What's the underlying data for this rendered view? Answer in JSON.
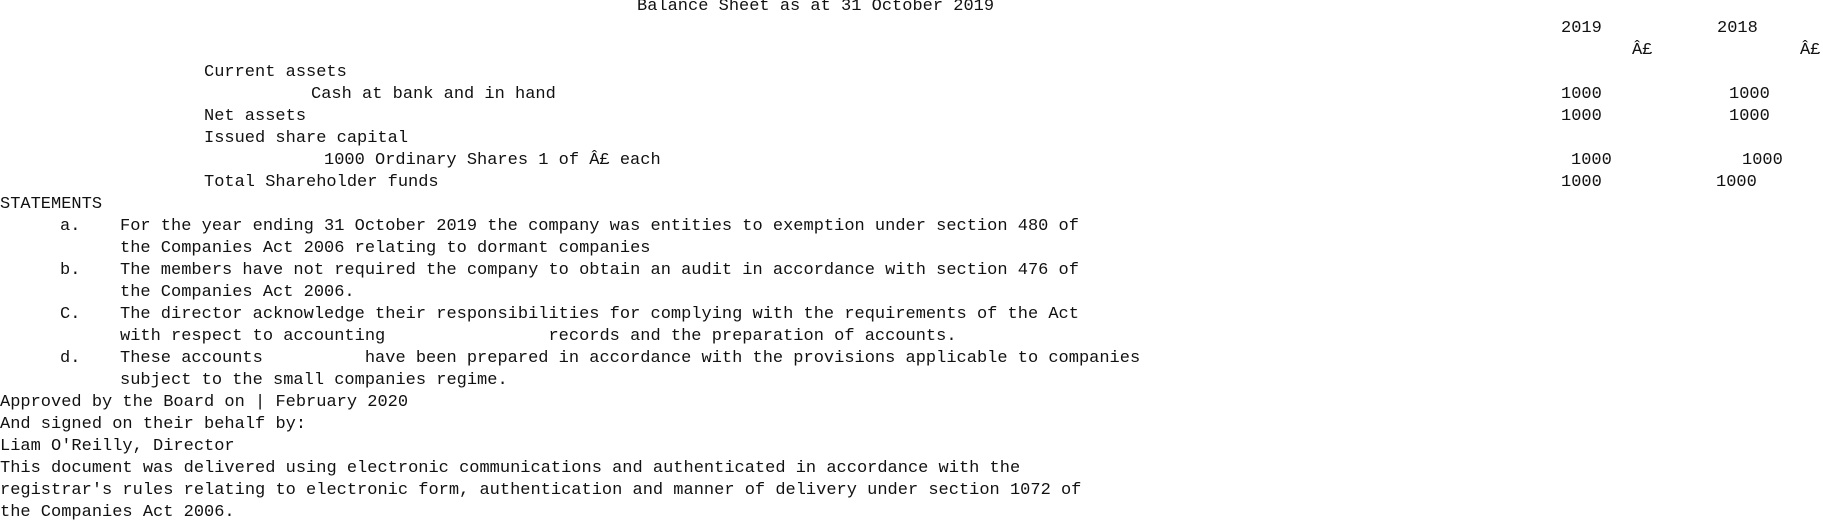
{
  "title": "Balance Sheet as at 31 October 2019",
  "columns": {
    "year_current": "2019",
    "year_prior": "2018",
    "currency_current": "Â£",
    "currency_prior": "Â£"
  },
  "balance_sheet": {
    "current_assets_label": "Current assets",
    "cash_label": "Cash at bank and in hand",
    "cash_2019": "1000",
    "cash_2018": "1000",
    "net_assets_label": "Net assets",
    "net_assets_2019": "1000",
    "net_assets_2018": "1000",
    "issued_share_capital_label": "Issued share capital",
    "shares_label": "1000 Ordinary Shares 1 of Â£ each",
    "shares_2019": "1000",
    "shares_2018": "1000",
    "total_funds_label": "Total Shareholder funds",
    "total_funds_2019": "1000",
    "total_funds_2018": "1000"
  },
  "statements": {
    "heading": "STATEMENTS",
    "items": [
      {
        "marker": "a.",
        "lines": [
          "For the year ending 31 October 2019 the company was entities to exemption under section 480 of",
          "the Companies Act 2006 relating to dormant companies"
        ]
      },
      {
        "marker": "b.",
        "lines": [
          "The members have not required the company to obtain an audit in accordance with section 476 of",
          "the Companies Act 2006."
        ]
      },
      {
        "marker": "C.",
        "lines": [
          "The director acknowledge their responsibilities for complying with the requirements of the Act",
          "with respect to accounting                records and the preparation of accounts."
        ]
      },
      {
        "marker": "d.",
        "lines": [
          "These accounts          have been prepared in accordance with the provisions applicable to companies",
          "subject to the small companies regime."
        ]
      }
    ]
  },
  "approval": {
    "approved_line": "Approved by the Board on | February 2020",
    "signed_line": "And signed on their behalf by:",
    "signatory": "Liam O'Reilly, Director"
  },
  "footer_lines": [
    "This document was delivered using electronic communications and authenticated in accordance with the",
    "registrar's rules relating to electronic form, authentication and manner of delivery under section 1072 of",
    "the Companies Act 2006."
  ]
}
